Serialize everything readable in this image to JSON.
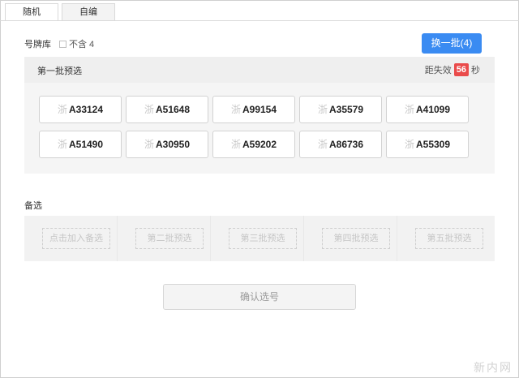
{
  "tabs": [
    {
      "label": "随机"
    },
    {
      "label": "自编"
    }
  ],
  "pool": {
    "label": "号牌库",
    "exclude_label": "不含 4"
  },
  "swap_button": {
    "label": "换一批(4)"
  },
  "batch": {
    "title": "第一批预选",
    "expire_prefix": "距失效",
    "seconds": "56",
    "unit": "秒"
  },
  "plates": [
    {
      "prov": "浙",
      "num": "A33124"
    },
    {
      "prov": "浙",
      "num": "A51648"
    },
    {
      "prov": "浙",
      "num": "A99154"
    },
    {
      "prov": "浙",
      "num": "A35579"
    },
    {
      "prov": "浙",
      "num": "A41099"
    },
    {
      "prov": "浙",
      "num": "A51490"
    },
    {
      "prov": "浙",
      "num": "A30950"
    },
    {
      "prov": "浙",
      "num": "A59202"
    },
    {
      "prov": "浙",
      "num": "A86736"
    },
    {
      "prov": "浙",
      "num": "A55309"
    }
  ],
  "backup": {
    "label": "备选",
    "slots": [
      "点击加入备选",
      "第二批预选",
      "第三批预选",
      "第四批预选",
      "第五批预选"
    ]
  },
  "confirm_button": {
    "label": "确认选号"
  },
  "watermark": "新内网",
  "colors": {
    "accent": "#3a8bf2",
    "badge": "#ea4b4b"
  }
}
